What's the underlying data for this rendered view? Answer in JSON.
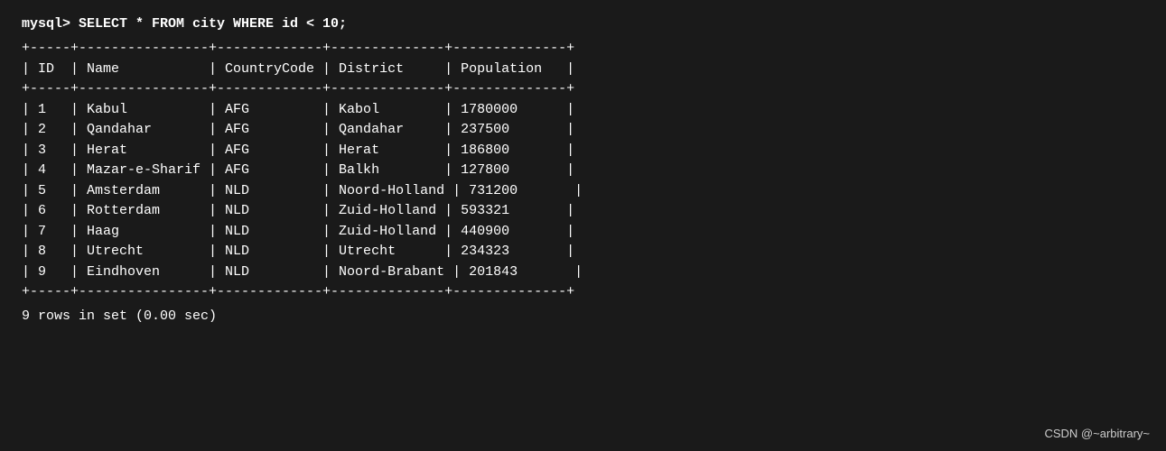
{
  "query": "mysql> SELECT * FROM city WHERE id < 10;",
  "divider": "+-----+----------------+-------------+--------------+--------------+",
  "headers": {
    "id": "ID",
    "name": "Name",
    "countrycode": "CountryCode",
    "district": "District",
    "population": "Population"
  },
  "rows": [
    {
      "id": "1",
      "name": "Kabul",
      "countrycode": "AFG",
      "district": "Kabol",
      "population": "1780000"
    },
    {
      "id": "2",
      "name": "Qandahar",
      "countrycode": "AFG",
      "district": "Qandahar",
      "population": "237500"
    },
    {
      "id": "3",
      "name": "Herat",
      "countrycode": "AFG",
      "district": "Herat",
      "population": "186800"
    },
    {
      "id": "4",
      "name": "Mazar-e-Sharif",
      "countrycode": "AFG",
      "district": "Balkh",
      "population": "127800"
    },
    {
      "id": "5",
      "name": "Amsterdam",
      "countrycode": "NLD",
      "district": "Noord-Holland",
      "population": "731200"
    },
    {
      "id": "6",
      "name": "Rotterdam",
      "countrycode": "NLD",
      "district": "Zuid-Holland",
      "population": "593321"
    },
    {
      "id": "7",
      "name": "Haag",
      "countrycode": "NLD",
      "district": "Zuid-Holland",
      "population": "440900"
    },
    {
      "id": "8",
      "name": "Utrecht",
      "countrycode": "NLD",
      "district": "Utrecht",
      "population": "234323"
    },
    {
      "id": "9",
      "name": "Eindhoven",
      "countrycode": "NLD",
      "district": "Noord-Brabant",
      "population": "201843"
    }
  ],
  "footer": "9 rows in set (0.00 sec)",
  "watermark": "CSDN @~arbitrary~"
}
